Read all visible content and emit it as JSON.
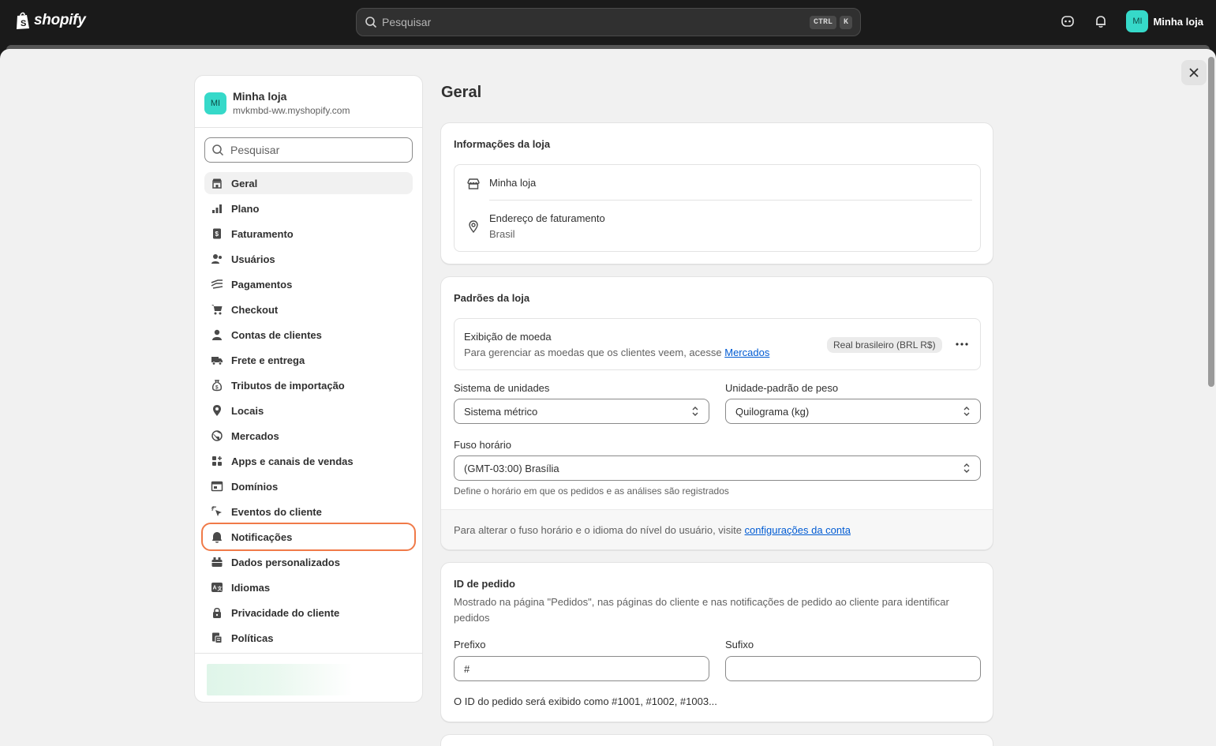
{
  "topbar": {
    "brand": "shopify",
    "search_placeholder": "Pesquisar",
    "kbd_ctrl": "CTRL",
    "kbd_k": "K",
    "store_initials": "MI",
    "store_name": "Minha loja"
  },
  "sidebar": {
    "store_initials": "MI",
    "store_name": "Minha loja",
    "store_domain": "mvkmbd-ww.myshopify.com",
    "search_placeholder": "Pesquisar",
    "items": [
      {
        "label": "Geral",
        "icon": "store-icon"
      },
      {
        "label": "Plano",
        "icon": "chart-icon"
      },
      {
        "label": "Faturamento",
        "icon": "invoice-icon"
      },
      {
        "label": "Usuários",
        "icon": "users-icon"
      },
      {
        "label": "Pagamentos",
        "icon": "payments-icon"
      },
      {
        "label": "Checkout",
        "icon": "cart-icon"
      },
      {
        "label": "Contas de clientes",
        "icon": "person-icon"
      },
      {
        "label": "Frete e entrega",
        "icon": "truck-icon"
      },
      {
        "label": "Tributos de importação",
        "icon": "money-bag-icon"
      },
      {
        "label": "Locais",
        "icon": "location-icon"
      },
      {
        "label": "Mercados",
        "icon": "globe-icon"
      },
      {
        "label": "Apps e canais de vendas",
        "icon": "apps-icon"
      },
      {
        "label": "Domínios",
        "icon": "domain-icon"
      },
      {
        "label": "Eventos do cliente",
        "icon": "cursor-icon"
      },
      {
        "label": "Notificações",
        "icon": "bell-icon"
      },
      {
        "label": "Dados personalizados",
        "icon": "database-icon"
      },
      {
        "label": "Idiomas",
        "icon": "language-icon"
      },
      {
        "label": "Privacidade do cliente",
        "icon": "lock-icon"
      },
      {
        "label": "Políticas",
        "icon": "policy-icon"
      }
    ]
  },
  "main": {
    "title": "Geral",
    "store_info": {
      "heading": "Informações da loja",
      "store_name": "Minha loja",
      "billing_label": "Endereço de faturamento",
      "billing_value": "Brasil"
    },
    "defaults": {
      "heading": "Padrões da loja",
      "currency_title": "Exibição de moeda",
      "currency_desc": "Para gerenciar as moedas que os clientes veem, acesse",
      "currency_link": "Mercados",
      "currency_badge": "Real brasileiro (BRL R$)",
      "units_label": "Sistema de unidades",
      "units_value": "Sistema métrico",
      "weight_label": "Unidade-padrão de peso",
      "weight_value": "Quilograma (kg)",
      "tz_label": "Fuso horário",
      "tz_value": "(GMT-03:00) Brasília",
      "tz_help": "Define o horário em que os pedidos e as análises são registrados",
      "footer_text": "Para alterar o fuso horário e o idioma do nível do usuário, visite",
      "footer_link": "configurações da conta"
    },
    "order_id": {
      "heading": "ID de pedido",
      "desc": "Mostrado na página \"Pedidos\", nas páginas do cliente e nas notificações de pedido ao cliente para identificar pedidos",
      "prefix_label": "Prefixo",
      "prefix_value": "#",
      "suffix_label": "Sufixo",
      "suffix_value": "",
      "preview": "O ID do pedido será exibido como #1001, #1002, #1003..."
    }
  },
  "colors": {
    "accent_outline": "#f07a48",
    "avatar": "#36d9c9",
    "link": "#005bd3"
  }
}
